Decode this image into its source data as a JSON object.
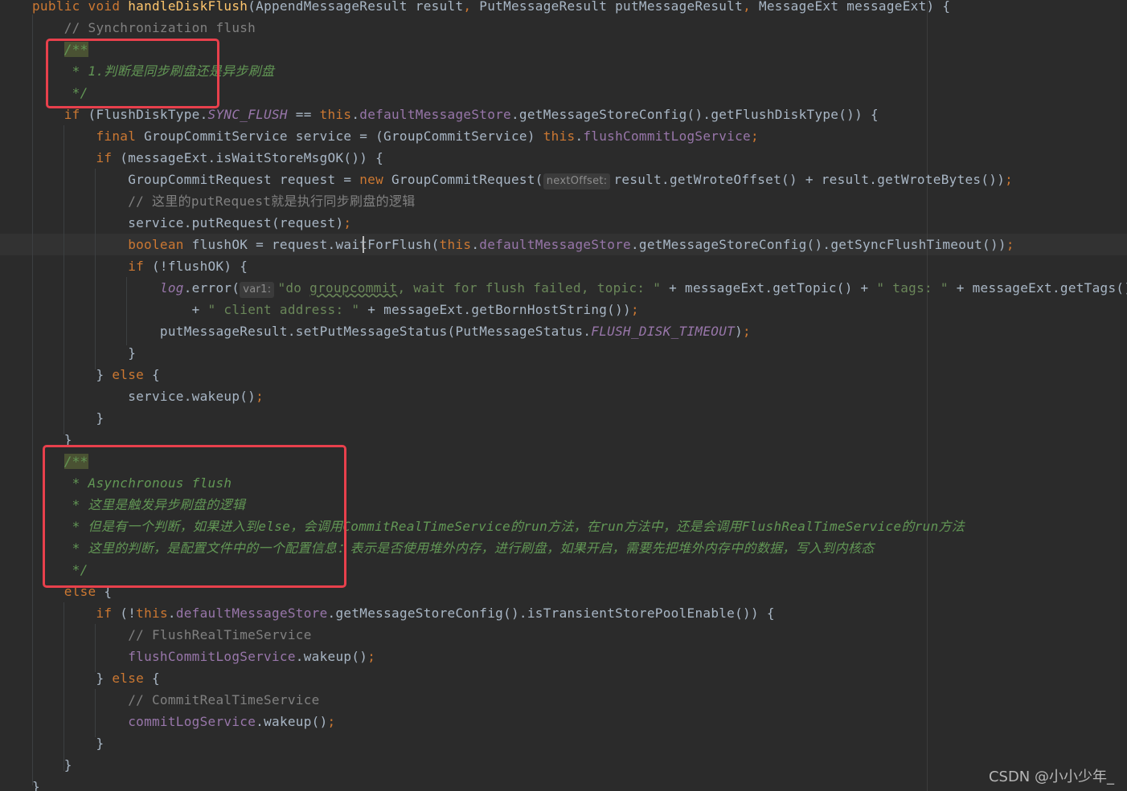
{
  "editor": {
    "colors": {
      "background": "#2b2b2b",
      "keyword": "#cc7832",
      "method_decl": "#ffc66d",
      "field": "#9876aa",
      "string": "#6a8759",
      "comment": "#808080",
      "doc_comment": "#629755",
      "default": "#a9b7c6",
      "annotation_box": "#e8404c"
    },
    "lines": [
      {
        "id": "l0",
        "segs": [
          {
            "t": "public void ",
            "c": "kw"
          },
          {
            "t": "handleDiskFlush",
            "c": "fn"
          },
          {
            "t": "(AppendMessageResult result",
            "c": "txt"
          },
          {
            "t": ", ",
            "c": "kw"
          },
          {
            "t": "PutMessageResult putMessageResult",
            "c": "txt"
          },
          {
            "t": ", ",
            "c": "kw"
          },
          {
            "t": "MessageExt messageExt) {",
            "c": "txt"
          }
        ]
      },
      {
        "id": "l1",
        "segs": [
          {
            "t": "    // Synchronization flush",
            "c": "cmt"
          }
        ]
      },
      {
        "id": "l2",
        "segs": [
          {
            "t": "    ",
            "c": "txt"
          },
          {
            "t": "/**",
            "c": "doc hl"
          }
        ]
      },
      {
        "id": "l3",
        "segs": [
          {
            "t": "     * 1.判断是同步刷盘还是异步刷盘",
            "c": "doc"
          }
        ]
      },
      {
        "id": "l4",
        "segs": [
          {
            "t": "     */",
            "c": "doc"
          }
        ]
      },
      {
        "id": "l5",
        "segs": [
          {
            "t": "    if ",
            "c": "kw"
          },
          {
            "t": "(FlushDiskType.",
            "c": "txt"
          },
          {
            "t": "SYNC_FLUSH",
            "c": "sfield"
          },
          {
            "t": " == ",
            "c": "txt"
          },
          {
            "t": "this",
            "c": "kw"
          },
          {
            "t": ".",
            "c": "txt"
          },
          {
            "t": "defaultMessageStore",
            "c": "field"
          },
          {
            "t": ".getMessageStoreConfig().getFlushDiskType()) {",
            "c": "txt"
          }
        ]
      },
      {
        "id": "l6",
        "segs": [
          {
            "t": "        final ",
            "c": "kw"
          },
          {
            "t": "GroupCommitService service = (GroupCommitService) ",
            "c": "txt"
          },
          {
            "t": "this",
            "c": "kw"
          },
          {
            "t": ".",
            "c": "txt"
          },
          {
            "t": "flushCommitLogService",
            "c": "field"
          },
          {
            "t": ";",
            "c": "semi"
          }
        ]
      },
      {
        "id": "l7",
        "segs": [
          {
            "t": "        if ",
            "c": "kw"
          },
          {
            "t": "(messageExt.isWaitStoreMsgOK()) {",
            "c": "txt"
          }
        ]
      },
      {
        "id": "l8",
        "segs": [
          {
            "t": "            GroupCommitRequest request = ",
            "c": "txt"
          },
          {
            "t": "new ",
            "c": "kw"
          },
          {
            "t": "GroupCommitRequest(",
            "c": "txt"
          },
          {
            "hint": "nextOffset:"
          },
          {
            "t": "result.getWroteOffset() + result.getWroteBytes())",
            "c": "txt"
          },
          {
            "t": ";",
            "c": "semi"
          }
        ]
      },
      {
        "id": "l9",
        "segs": [
          {
            "t": "            // 这里的putRequest就是执行同步刷盘的逻辑",
            "c": "cmt"
          }
        ]
      },
      {
        "id": "l10",
        "segs": [
          {
            "t": "            service.putRequest(request)",
            "c": "txt"
          },
          {
            "t": ";",
            "c": "semi"
          }
        ]
      },
      {
        "id": "l11",
        "segs": [
          {
            "t": "            boolean ",
            "c": "kw"
          },
          {
            "t": "flushOK = request.",
            "c": "txt"
          },
          {
            "t": "waitForFlush",
            "c": "txt"
          },
          {
            "t": "(",
            "c": "txt"
          },
          {
            "t": "this",
            "c": "kw"
          },
          {
            "t": ".",
            "c": "txt"
          },
          {
            "t": "defaultMessageStore",
            "c": "field"
          },
          {
            "t": ".getMessageStoreConfig().getSyncFlushTimeout())",
            "c": "txt"
          },
          {
            "t": ";",
            "c": "semi"
          }
        ]
      },
      {
        "id": "l12",
        "segs": [
          {
            "t": "            if ",
            "c": "kw"
          },
          {
            "t": "(!flushOK) {",
            "c": "txt"
          }
        ]
      },
      {
        "id": "l13",
        "segs": [
          {
            "t": "                ",
            "c": "txt"
          },
          {
            "t": "log",
            "c": "sfield"
          },
          {
            "t": ".error(",
            "c": "txt"
          },
          {
            "hint": "var1:"
          },
          {
            "t": "\"do ",
            "c": "str"
          },
          {
            "t": "groupcommit",
            "c": "str uline"
          },
          {
            "t": ", wait for flush failed, topic: \"",
            "c": "str"
          },
          {
            "t": " + messageExt.getTopic() + ",
            "c": "txt"
          },
          {
            "t": "\" tags: \"",
            "c": "str"
          },
          {
            "t": " + messageExt.getTags()",
            "c": "txt"
          }
        ]
      },
      {
        "id": "l14",
        "segs": [
          {
            "t": "                    + ",
            "c": "txt"
          },
          {
            "t": "\" client address: \"",
            "c": "str"
          },
          {
            "t": " + messageExt.getBornHostString())",
            "c": "txt"
          },
          {
            "t": ";",
            "c": "semi"
          }
        ]
      },
      {
        "id": "l15",
        "segs": [
          {
            "t": "                putMessageResult.setPutMessageStatus(PutMessageStatus.",
            "c": "txt"
          },
          {
            "t": "FLUSH_DISK_TIMEOUT",
            "c": "sfield"
          },
          {
            "t": ")",
            "c": "txt"
          },
          {
            "t": ";",
            "c": "semi"
          }
        ]
      },
      {
        "id": "l16",
        "segs": [
          {
            "t": "            }",
            "c": "txt"
          }
        ]
      },
      {
        "id": "l17",
        "segs": [
          {
            "t": "        } ",
            "c": "txt"
          },
          {
            "t": "else ",
            "c": "kw"
          },
          {
            "t": "{",
            "c": "txt"
          }
        ]
      },
      {
        "id": "l18",
        "segs": [
          {
            "t": "            service.wakeup()",
            "c": "txt"
          },
          {
            "t": ";",
            "c": "semi"
          }
        ]
      },
      {
        "id": "l19",
        "segs": [
          {
            "t": "        }",
            "c": "txt"
          }
        ]
      },
      {
        "id": "l20",
        "segs": [
          {
            "t": "    }",
            "c": "txt"
          }
        ]
      },
      {
        "id": "l21",
        "segs": [
          {
            "t": "    ",
            "c": "txt"
          },
          {
            "t": "/**",
            "c": "doc hl"
          }
        ]
      },
      {
        "id": "l22",
        "segs": [
          {
            "t": "     * Asynchronous flush",
            "c": "doc"
          }
        ]
      },
      {
        "id": "l23",
        "segs": [
          {
            "t": "     * 这里是触发异步刷盘的逻辑",
            "c": "doc"
          }
        ]
      },
      {
        "id": "l24",
        "segs": [
          {
            "t": "     * 但是有一个判断，如果进入到else，会调用CommitRealTimeService的run方法，在run方法中，还是会调用FlushRealTimeService的run方法",
            "c": "doc"
          }
        ]
      },
      {
        "id": "l25",
        "segs": [
          {
            "t": "     * 这里的判断，是配置文件中的一个配置信息：表示是否使用堆外内存，进行刷盘，如果开启，需要先把堆外内存中的数据，写入到内核态",
            "c": "doc"
          }
        ]
      },
      {
        "id": "l26",
        "segs": [
          {
            "t": "     */",
            "c": "doc"
          }
        ]
      },
      {
        "id": "l27",
        "segs": [
          {
            "t": "    else ",
            "c": "kw"
          },
          {
            "t": "{",
            "c": "txt"
          }
        ]
      },
      {
        "id": "l28",
        "segs": [
          {
            "t": "        if ",
            "c": "kw"
          },
          {
            "t": "(!",
            "c": "txt"
          },
          {
            "t": "this",
            "c": "kw"
          },
          {
            "t": ".",
            "c": "txt"
          },
          {
            "t": "defaultMessageStore",
            "c": "field"
          },
          {
            "t": ".getMessageStoreConfig().isTransientStorePoolEnable()) {",
            "c": "txt"
          }
        ]
      },
      {
        "id": "l29",
        "segs": [
          {
            "t": "            // FlushRealTimeService",
            "c": "cmt"
          }
        ]
      },
      {
        "id": "l30",
        "segs": [
          {
            "t": "            ",
            "c": "txt"
          },
          {
            "t": "flushCommitLogService",
            "c": "field"
          },
          {
            "t": ".wakeup()",
            "c": "txt"
          },
          {
            "t": ";",
            "c": "semi"
          }
        ]
      },
      {
        "id": "l31",
        "segs": [
          {
            "t": "        } ",
            "c": "txt"
          },
          {
            "t": "else ",
            "c": "kw"
          },
          {
            "t": "{",
            "c": "txt"
          }
        ]
      },
      {
        "id": "l32",
        "segs": [
          {
            "t": "            // CommitRealTimeService",
            "c": "cmt"
          }
        ]
      },
      {
        "id": "l33",
        "segs": [
          {
            "t": "            ",
            "c": "txt"
          },
          {
            "t": "commitLogService",
            "c": "field"
          },
          {
            "t": ".wakeup()",
            "c": "txt"
          },
          {
            "t": ";",
            "c": "semi"
          }
        ]
      },
      {
        "id": "l34",
        "segs": [
          {
            "t": "        }",
            "c": "txt"
          }
        ]
      },
      {
        "id": "l35",
        "segs": [
          {
            "t": "    }",
            "c": "txt"
          }
        ]
      },
      {
        "id": "l36",
        "segs": [
          {
            "t": "}",
            "c": "txt"
          }
        ]
      }
    ]
  },
  "watermark": "CSDN @小小少年_"
}
